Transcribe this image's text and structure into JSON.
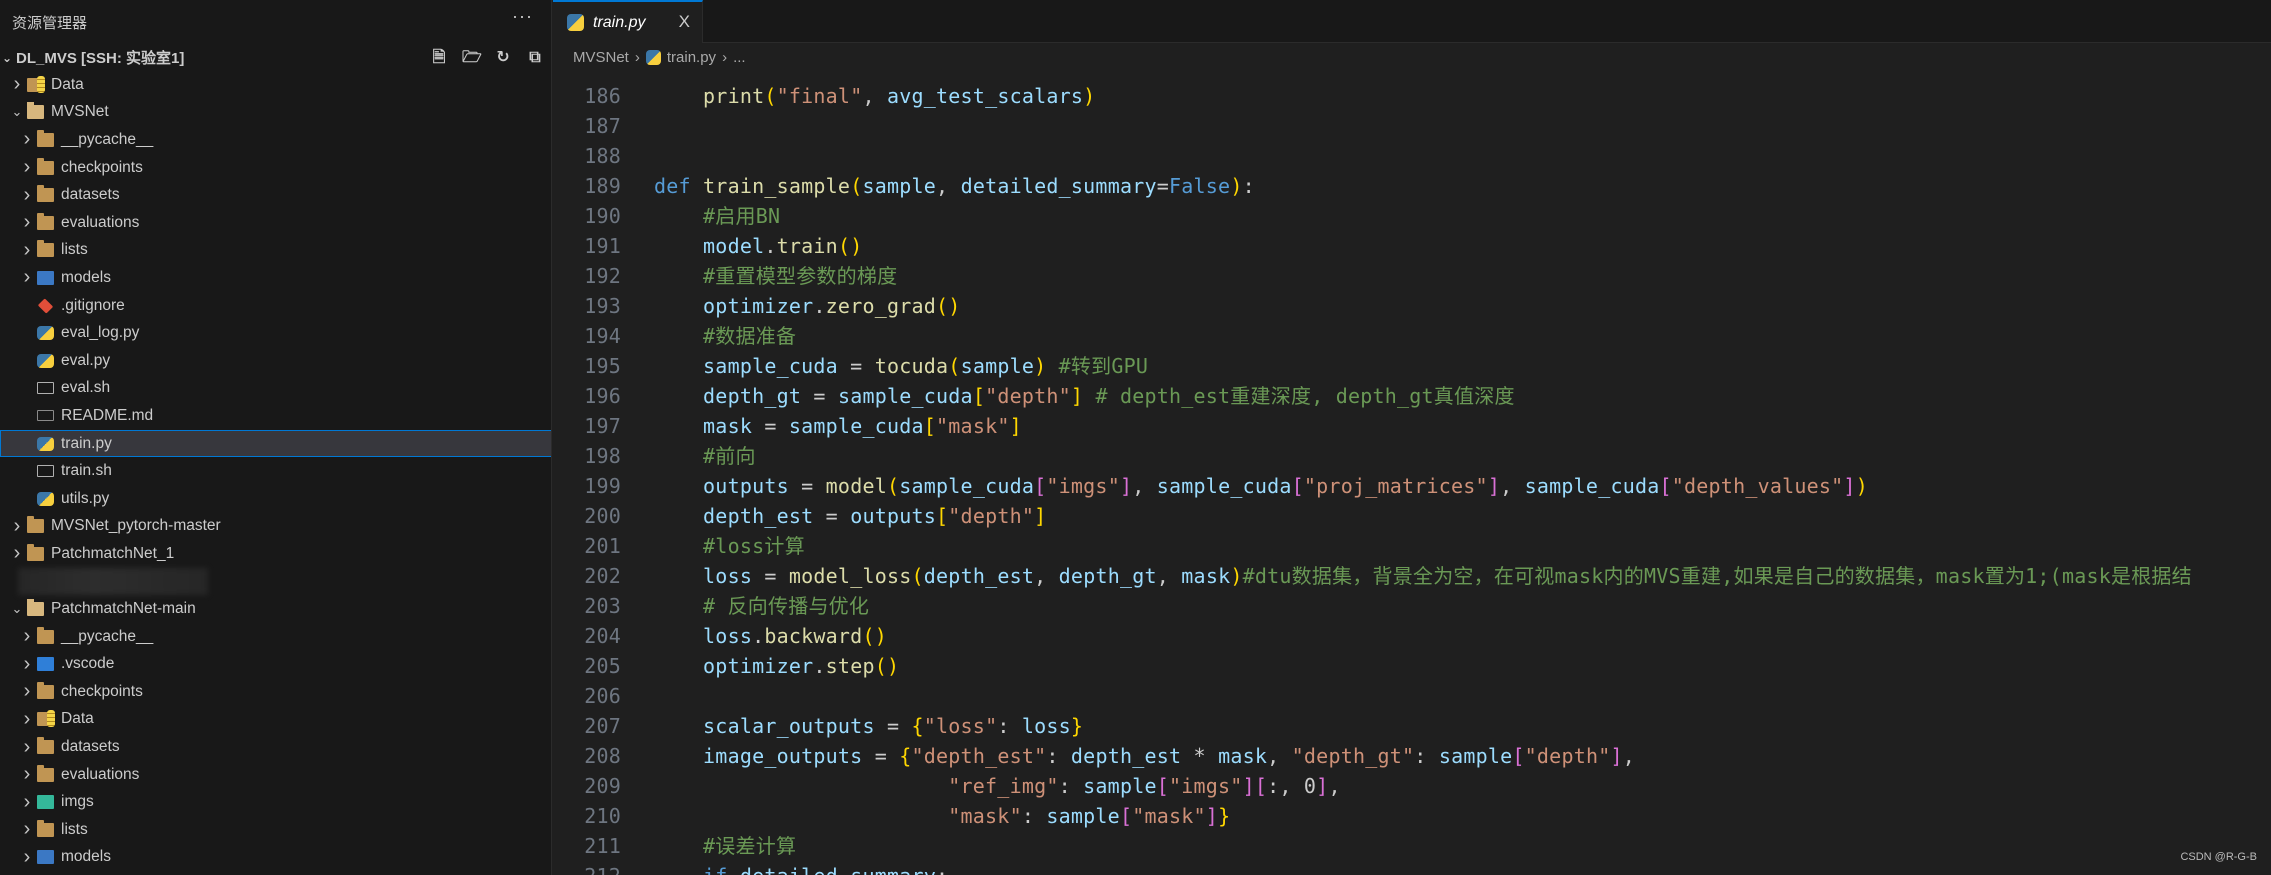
{
  "sidebar": {
    "title": "资源管理器",
    "more": "···",
    "root": "DL_MVS [SSH: 实验室1]",
    "actions": [
      "new-file-icon",
      "new-folder-icon",
      "refresh-icon",
      "collapse-all-icon"
    ],
    "items": [
      {
        "label": "Data",
        "depth": 0,
        "chev": ">",
        "icon": "data"
      },
      {
        "label": "MVSNet",
        "depth": 0,
        "chev": "v",
        "icon": "folder-open"
      },
      {
        "label": "__pycache__",
        "depth": 1,
        "chev": ">",
        "icon": "folder"
      },
      {
        "label": "checkpoints",
        "depth": 1,
        "chev": ">",
        "icon": "folder"
      },
      {
        "label": "datasets",
        "depth": 1,
        "chev": ">",
        "icon": "folder"
      },
      {
        "label": "evaluations",
        "depth": 1,
        "chev": ">",
        "icon": "folder"
      },
      {
        "label": "lists",
        "depth": 1,
        "chev": ">",
        "icon": "folder"
      },
      {
        "label": "models",
        "depth": 1,
        "chev": ">",
        "icon": "models"
      },
      {
        "label": ".gitignore",
        "depth": 1,
        "chev": "",
        "icon": "git"
      },
      {
        "label": "eval_log.py",
        "depth": 1,
        "chev": "",
        "icon": "py"
      },
      {
        "label": "eval.py",
        "depth": 1,
        "chev": "",
        "icon": "py"
      },
      {
        "label": "eval.sh",
        "depth": 1,
        "chev": "",
        "icon": "sh"
      },
      {
        "label": "README.md",
        "depth": 1,
        "chev": "",
        "icon": "md"
      },
      {
        "label": "train.py",
        "depth": 1,
        "chev": "",
        "icon": "py",
        "selected": true
      },
      {
        "label": "train.sh",
        "depth": 1,
        "chev": "",
        "icon": "sh"
      },
      {
        "label": "utils.py",
        "depth": 1,
        "chev": "",
        "icon": "py"
      },
      {
        "label": "MVSNet_pytorch-master",
        "depth": 0,
        "chev": ">",
        "icon": "folder"
      },
      {
        "label": "PatchmatchNet_1",
        "depth": 0,
        "chev": ">",
        "icon": "folder"
      },
      {
        "blurred": true
      },
      {
        "label": "PatchmatchNet-main",
        "depth": 0,
        "chev": "v",
        "icon": "folder-open"
      },
      {
        "label": "__pycache__",
        "depth": 1,
        "chev": ">",
        "icon": "folder"
      },
      {
        "label": ".vscode",
        "depth": 1,
        "chev": ">",
        "icon": "vscode"
      },
      {
        "label": "checkpoints",
        "depth": 1,
        "chev": ">",
        "icon": "folder"
      },
      {
        "label": "Data",
        "depth": 1,
        "chev": ">",
        "icon": "data"
      },
      {
        "label": "datasets",
        "depth": 1,
        "chev": ">",
        "icon": "folder"
      },
      {
        "label": "evaluations",
        "depth": 1,
        "chev": ">",
        "icon": "folder"
      },
      {
        "label": "imgs",
        "depth": 1,
        "chev": ">",
        "icon": "imgs"
      },
      {
        "label": "lists",
        "depth": 1,
        "chev": ">",
        "icon": "folder"
      },
      {
        "label": "models",
        "depth": 1,
        "chev": ">",
        "icon": "models"
      }
    ]
  },
  "tab": {
    "label": "train.py",
    "close": "X"
  },
  "breadcrumb": {
    "folder": "MVSNet",
    "file": "train.py",
    "more": "..."
  },
  "editor": {
    "lines": [
      {
        "n": "186",
        "t": [
          [
            "p",
            "    "
          ],
          [
            "fn",
            "print"
          ],
          [
            "b1",
            "("
          ],
          [
            "str",
            "\"final\""
          ],
          [
            "p",
            ", "
          ],
          [
            "var",
            "avg_test_scalars"
          ],
          [
            "b1",
            ")"
          ]
        ]
      },
      {
        "n": "187",
        "t": []
      },
      {
        "n": "188",
        "t": []
      },
      {
        "n": "189",
        "t": [
          [
            "kw",
            "def "
          ],
          [
            "fn",
            "train_sample"
          ],
          [
            "b1",
            "("
          ],
          [
            "var",
            "sample"
          ],
          [
            "p",
            ", "
          ],
          [
            "var",
            "detailed_summary"
          ],
          [
            "p",
            "="
          ],
          [
            "kw",
            "False"
          ],
          [
            "b1",
            ")"
          ],
          [
            "p",
            ":"
          ]
        ]
      },
      {
        "n": "190",
        "t": [
          [
            "p",
            "    "
          ],
          [
            "com",
            "#启用BN"
          ]
        ]
      },
      {
        "n": "191",
        "t": [
          [
            "p",
            "    "
          ],
          [
            "var",
            "model"
          ],
          [
            "p",
            "."
          ],
          [
            "fn",
            "train"
          ],
          [
            "b1",
            "()"
          ]
        ]
      },
      {
        "n": "192",
        "t": [
          [
            "p",
            "    "
          ],
          [
            "com",
            "#重置模型参数的梯度"
          ]
        ]
      },
      {
        "n": "193",
        "t": [
          [
            "p",
            "    "
          ],
          [
            "var",
            "optimizer"
          ],
          [
            "p",
            "."
          ],
          [
            "fn",
            "zero_grad"
          ],
          [
            "b1",
            "()"
          ]
        ]
      },
      {
        "n": "194",
        "t": [
          [
            "p",
            "    "
          ],
          [
            "com",
            "#数据准备"
          ]
        ]
      },
      {
        "n": "195",
        "t": [
          [
            "p",
            "    "
          ],
          [
            "var",
            "sample_cuda"
          ],
          [
            "p",
            " = "
          ],
          [
            "fn",
            "tocuda"
          ],
          [
            "b1",
            "("
          ],
          [
            "var",
            "sample"
          ],
          [
            "b1",
            ")"
          ],
          [
            "p",
            " "
          ],
          [
            "com",
            "#转到GPU"
          ]
        ]
      },
      {
        "n": "196",
        "t": [
          [
            "p",
            "    "
          ],
          [
            "var",
            "depth_gt"
          ],
          [
            "p",
            " = "
          ],
          [
            "var",
            "sample_cuda"
          ],
          [
            "b1",
            "["
          ],
          [
            "str",
            "\"depth\""
          ],
          [
            "b1",
            "]"
          ],
          [
            "p",
            " "
          ],
          [
            "com",
            "# depth_est重建深度, depth_gt真值深度"
          ]
        ]
      },
      {
        "n": "197",
        "t": [
          [
            "p",
            "    "
          ],
          [
            "var",
            "mask"
          ],
          [
            "p",
            " = "
          ],
          [
            "var",
            "sample_cuda"
          ],
          [
            "b1",
            "["
          ],
          [
            "str",
            "\"mask\""
          ],
          [
            "b1",
            "]"
          ]
        ]
      },
      {
        "n": "198",
        "t": [
          [
            "p",
            "    "
          ],
          [
            "com",
            "#前向"
          ]
        ]
      },
      {
        "n": "199",
        "t": [
          [
            "p",
            "    "
          ],
          [
            "var",
            "outputs"
          ],
          [
            "p",
            " = "
          ],
          [
            "fn",
            "model"
          ],
          [
            "b1",
            "("
          ],
          [
            "var",
            "sample_cuda"
          ],
          [
            "b2",
            "["
          ],
          [
            "str",
            "\"imgs\""
          ],
          [
            "b2",
            "]"
          ],
          [
            "p",
            ", "
          ],
          [
            "var",
            "sample_cuda"
          ],
          [
            "b2",
            "["
          ],
          [
            "str",
            "\"proj_matrices\""
          ],
          [
            "b2",
            "]"
          ],
          [
            "p",
            ", "
          ],
          [
            "var",
            "sample_cuda"
          ],
          [
            "b2",
            "["
          ],
          [
            "str",
            "\"depth_values\""
          ],
          [
            "b2",
            "]"
          ],
          [
            "b1",
            ")"
          ]
        ]
      },
      {
        "n": "200",
        "t": [
          [
            "p",
            "    "
          ],
          [
            "var",
            "depth_est"
          ],
          [
            "p",
            " = "
          ],
          [
            "var",
            "outputs"
          ],
          [
            "b1",
            "["
          ],
          [
            "str",
            "\"depth\""
          ],
          [
            "b1",
            "]"
          ]
        ]
      },
      {
        "n": "201",
        "t": [
          [
            "p",
            "    "
          ],
          [
            "com",
            "#loss计算"
          ]
        ]
      },
      {
        "n": "202",
        "t": [
          [
            "p",
            "    "
          ],
          [
            "var",
            "loss"
          ],
          [
            "p",
            " = "
          ],
          [
            "fn",
            "model_loss"
          ],
          [
            "b1",
            "("
          ],
          [
            "var",
            "depth_est"
          ],
          [
            "p",
            ", "
          ],
          [
            "var",
            "depth_gt"
          ],
          [
            "p",
            ", "
          ],
          [
            "var",
            "mask"
          ],
          [
            "b1",
            ")"
          ],
          [
            "com",
            "#dtu数据集，背景全为空，在可视mask内的MVS重建,如果是自己的数据集，mask置为1;(mask是根据结"
          ]
        ]
      },
      {
        "n": "203",
        "t": [
          [
            "p",
            "    "
          ],
          [
            "com",
            "# 反向传播与优化"
          ]
        ]
      },
      {
        "n": "204",
        "t": [
          [
            "p",
            "    "
          ],
          [
            "var",
            "loss"
          ],
          [
            "p",
            "."
          ],
          [
            "fn",
            "backward"
          ],
          [
            "b1",
            "()"
          ]
        ]
      },
      {
        "n": "205",
        "t": [
          [
            "p",
            "    "
          ],
          [
            "var",
            "optimizer"
          ],
          [
            "p",
            "."
          ],
          [
            "fn",
            "step"
          ],
          [
            "b1",
            "()"
          ]
        ]
      },
      {
        "n": "206",
        "t": []
      },
      {
        "n": "207",
        "t": [
          [
            "p",
            "    "
          ],
          [
            "var",
            "scalar_outputs"
          ],
          [
            "p",
            " = "
          ],
          [
            "b1",
            "{"
          ],
          [
            "str",
            "\"loss\""
          ],
          [
            "p",
            ": "
          ],
          [
            "var",
            "loss"
          ],
          [
            "b1",
            "}"
          ]
        ]
      },
      {
        "n": "208",
        "t": [
          [
            "p",
            "    "
          ],
          [
            "var",
            "image_outputs"
          ],
          [
            "p",
            " = "
          ],
          [
            "b1",
            "{"
          ],
          [
            "str",
            "\"depth_est\""
          ],
          [
            "p",
            ": "
          ],
          [
            "var",
            "depth_est"
          ],
          [
            "p",
            " * "
          ],
          [
            "var",
            "mask"
          ],
          [
            "p",
            ", "
          ],
          [
            "str",
            "\"depth_gt\""
          ],
          [
            "p",
            ": "
          ],
          [
            "var",
            "sample"
          ],
          [
            "b2",
            "["
          ],
          [
            "str",
            "\"depth\""
          ],
          [
            "b2",
            "]"
          ],
          [
            "p",
            ","
          ]
        ]
      },
      {
        "n": "209",
        "t": [
          [
            "p",
            "                        "
          ],
          [
            "str",
            "\"ref_img\""
          ],
          [
            "p",
            ": "
          ],
          [
            "var",
            "sample"
          ],
          [
            "b2",
            "["
          ],
          [
            "str",
            "\"imgs\""
          ],
          [
            "b2",
            "]"
          ],
          [
            "b2",
            "["
          ],
          [
            "p",
            ":, "
          ],
          [
            "p",
            "0"
          ],
          [
            "b2",
            "]"
          ],
          [
            "p",
            ","
          ]
        ]
      },
      {
        "n": "210",
        "t": [
          [
            "p",
            "                        "
          ],
          [
            "str",
            "\"mask\""
          ],
          [
            "p",
            ": "
          ],
          [
            "var",
            "sample"
          ],
          [
            "b2",
            "["
          ],
          [
            "str",
            "\"mask\""
          ],
          [
            "b2",
            "]"
          ],
          [
            "b1",
            "}"
          ]
        ]
      },
      {
        "n": "211",
        "t": [
          [
            "p",
            "    "
          ],
          [
            "com",
            "#误差计算"
          ]
        ]
      },
      {
        "n": "212",
        "t": [
          [
            "p",
            "    "
          ],
          [
            "kw",
            "if "
          ],
          [
            "var",
            "detailed_summary"
          ],
          [
            "p",
            ":"
          ]
        ]
      }
    ]
  },
  "watermark": "CSDN @R-G-B",
  "colors": {
    "accent": "#0078d4",
    "keyword": "#569cd6",
    "function": "#dcdcaa",
    "variable": "#9cdcfe",
    "string": "#ce9178",
    "comment": "#6a9955"
  }
}
